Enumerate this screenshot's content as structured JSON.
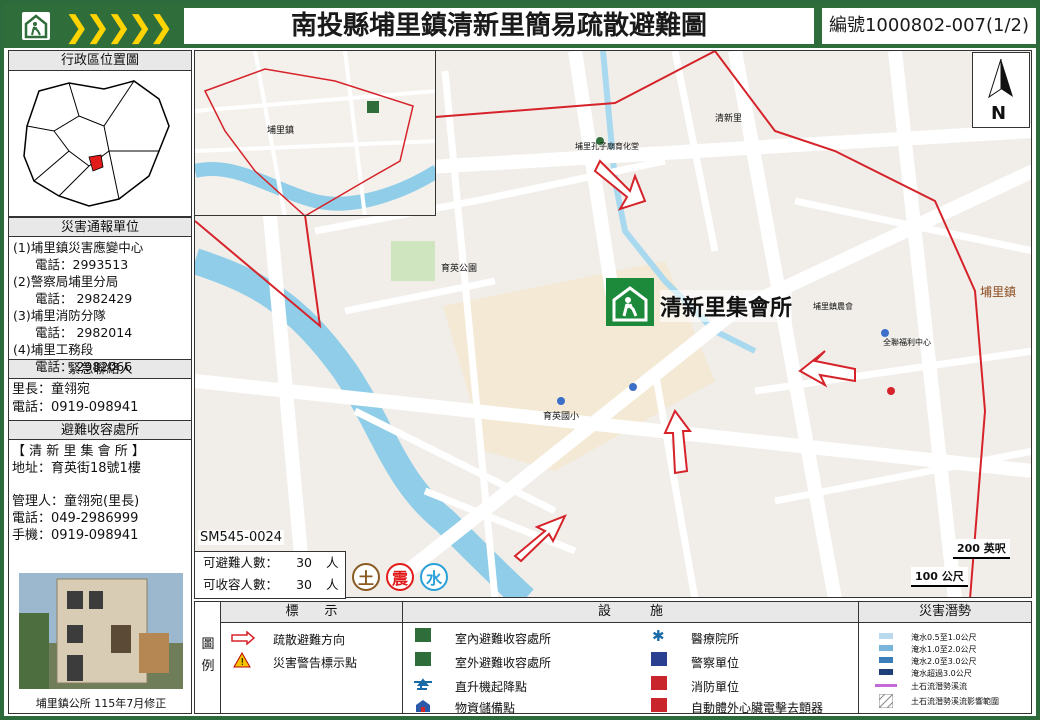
{
  "header": {
    "chevrons": "❯❯❯❯❯",
    "title": "南投縣埔里鎮清新里簡易疏散避難圖",
    "code": "編號1000802-007(1/2)"
  },
  "left": {
    "location_title": "行政區位置圖",
    "report_title": "災害通報單位",
    "report_units": [
      {
        "name": "(1)埔里鎮災害應變中心",
        "phone": "電話：2993513"
      },
      {
        "name": "(2)警察局埔里分局",
        "phone": "電話： 2982429"
      },
      {
        "name": "(3)埔里消防分隊",
        "phone": "電話： 2982014"
      },
      {
        "name": "(4)埔里工務段",
        "phone": "電話： 2982066"
      }
    ],
    "contact_title": "緊急聯絡人",
    "contact_chief": "里長：童翎宛",
    "contact_phone": "電話：0919-098941",
    "shelter_title": "避難收容處所",
    "shelter_name": "【 清 新 里 集 會 所 】",
    "shelter_addr": "地址：育英街18號1樓",
    "manager": "管理人：童翎宛(里長)",
    "manager_phone": "電話：049-2986999",
    "manager_mobile": "手機：0919-098941",
    "photo_caption": "埔里鎮公所 115年7月修正"
  },
  "map": {
    "shelter_label": "清新里集會所",
    "north": "N",
    "scale_ft": "200 英呎",
    "scale_m": "100 公尺",
    "sm_code": "SM545-0024",
    "inset_town": "埔里鎮",
    "labels": {
      "park": "育英公園",
      "school": "育英國小",
      "qingxin": "清新里",
      "puli": "埔里鎮",
      "garden": "埔里孔子廟育化堂",
      "hall": "埔里鎮農會",
      "market": "全聯福利中心"
    }
  },
  "capacity": {
    "evac_label": "可避難人數：",
    "evac_value": "30",
    "shelter_label": "可收容人數：",
    "shelter_value": "30",
    "unit": "人",
    "hazards": [
      "土",
      "震",
      "水"
    ]
  },
  "legend": {
    "side": "圖例",
    "col1_title": "標　　示",
    "col2_title": "設　　　施",
    "col3_title": "災害潛勢",
    "items_col1": [
      "疏散避難方向",
      "災害警告標示點"
    ],
    "items_col2a": [
      "室內避難收容處所",
      "室外避難收容處所",
      "直升機起降點",
      "物資儲備點"
    ],
    "items_col2b": [
      "醫療院所",
      "警察單位",
      "消防單位",
      "自動體外心臟電擊去顫器"
    ],
    "flood": [
      "淹水0.5至1.0公尺",
      "淹水1.0至2.0公尺",
      "淹水2.0至3.0公尺",
      "淹水超過3.0公尺",
      "土石流潛勢溪流",
      "土石流潛勢溪流影響範圍"
    ],
    "colors": {
      "green": "#2f6e3b",
      "route_red": "#d6232a",
      "flood1": "#b9d9ee",
      "flood2": "#79b4dc",
      "flood3": "#3a7db8",
      "flood4": "#1f3f7a",
      "debris": "#c36ad6"
    }
  }
}
